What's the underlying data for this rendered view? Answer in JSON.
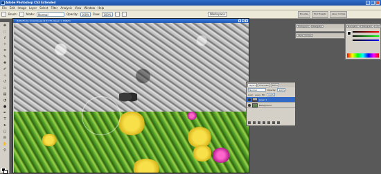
{
  "app": {
    "title": "Adobe Photoshop CS3 Extended"
  },
  "menu": [
    "File",
    "Edit",
    "Image",
    "Layer",
    "Select",
    "Filter",
    "Analysis",
    "View",
    "Window",
    "Help"
  ],
  "options": {
    "brush_label": "Brush:",
    "mode_label": "Mode:",
    "mode_value": "Normal",
    "opacity_label": "Opacity:",
    "opacity_value": "100%",
    "flow_label": "Flow:",
    "flow_value": "100%",
    "workspace_label": "Workspace"
  },
  "dock_tabs": [
    "Brushes",
    "Tool Presets",
    "Layer Comps"
  ],
  "document": {
    "title": "Butterfly by ioneanta.jpg @ 33.3% (Layer 1, RGB/8)"
  },
  "layers_panel": {
    "tabs": [
      "Layers",
      "Channels",
      "Paths"
    ],
    "blend_mode": "Normal",
    "opacity_label": "Opacity:",
    "opacity_value": "100%",
    "lock_label": "Lock:",
    "fill_label": "Fill:",
    "fill_value": "100%",
    "layers": [
      {
        "name": "Layer 1",
        "selected": true
      },
      {
        "name": "Background",
        "selected": false
      }
    ]
  },
  "side_panels": {
    "info_tabs": [
      "Histogram",
      "Navigator"
    ],
    "color_tabs": [
      "Navigator",
      "Histogram",
      "Info"
    ],
    "layer_comps_label": "Layer Comps"
  },
  "colors": {
    "titlebar": "#1d4fa5",
    "selected_layer": "#3169c6",
    "foreground": "#000000",
    "background": "#ffffff"
  }
}
